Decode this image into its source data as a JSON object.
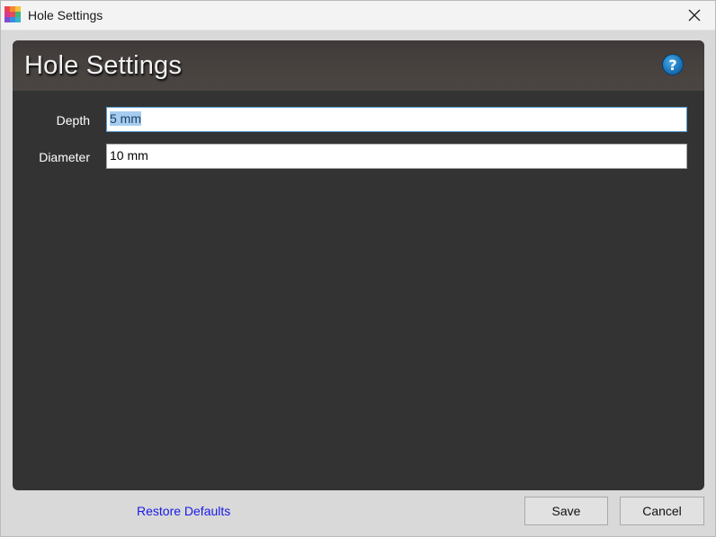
{
  "window": {
    "title": "Hole Settings"
  },
  "header": {
    "title": "Hole Settings",
    "help_glyph": "?"
  },
  "fields": [
    {
      "label": "Depth",
      "value": "5 mm"
    },
    {
      "label": "Diameter",
      "value": "10 mm"
    }
  ],
  "footer": {
    "restore_label": "Restore Defaults",
    "save_label": "Save",
    "cancel_label": "Cancel"
  },
  "icons": {
    "app": "app-icon",
    "close": "close-icon",
    "help": "help-icon"
  },
  "colors": {
    "panel_bg": "#333333",
    "header_bg": "#48423f",
    "link": "#1a1ae6",
    "help_blue": "#1a72b8",
    "selection": "#a6cdef"
  }
}
